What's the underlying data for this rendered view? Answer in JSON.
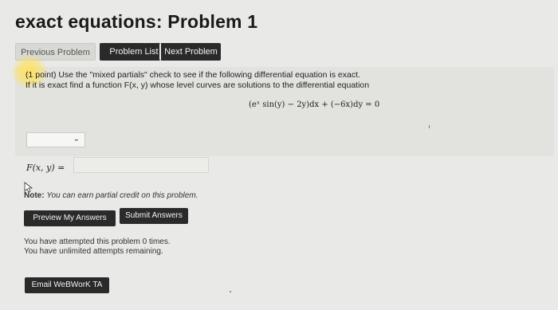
{
  "page": {
    "title": "exact equations: Problem 1"
  },
  "nav": {
    "prev_label": "Previous Problem",
    "list_label": "Problem List",
    "next_label": "Next Problem"
  },
  "problem": {
    "line1": "(1 point) Use the \"mixed partials\" check to see if the following differential equation is exact.",
    "line2": "If it is exact find a function F(x, y) whose level curves are solutions to the differential equation",
    "equation": "(eˣ sin(y) − 2y)dx + (−6x)dy = 0"
  },
  "answer": {
    "select_value": "",
    "f_label": "F(x, y) =",
    "f_value": ""
  },
  "note": {
    "bold": "Note:",
    "text": "You can earn partial credit on this problem."
  },
  "actions": {
    "preview_label": "Preview My Answers",
    "submit_label": "Submit Answers",
    "email_label": "Email WeBWorK TA"
  },
  "attempts": {
    "line1": "You have attempted this problem 0 times.",
    "line2": "You have unlimited attempts remaining."
  },
  "icons": {
    "select_chevron": "chevron-down-icon",
    "cursor": "mouse-pointer-icon"
  }
}
